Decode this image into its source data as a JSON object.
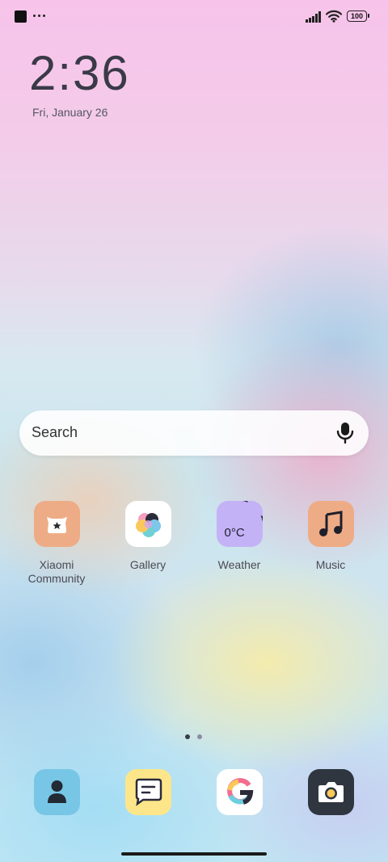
{
  "status_bar": {
    "battery": "100",
    "icons": [
      "app-notification-icon",
      "more-notifications-icon",
      "signal-icon",
      "wifi-icon",
      "battery-icon"
    ]
  },
  "lock": {
    "time": "2:36",
    "date": "Fri, January 26"
  },
  "search": {
    "placeholder": "Search",
    "icon": "mic-icon"
  },
  "apps": [
    {
      "label": "Xiaomi Community",
      "line1": "Xiaomi",
      "line2": "Community",
      "icon": "xiaomi-community-icon",
      "bg": "#eeac86"
    },
    {
      "label": "Gallery",
      "icon": "gallery-icon",
      "bg": "#ffffff"
    },
    {
      "label": "Weather",
      "icon": "weather-icon",
      "bg": "#c4b2f7",
      "temp": "0°C"
    },
    {
      "label": "Music",
      "icon": "music-icon",
      "bg": "#eeac86"
    }
  ],
  "pager": {
    "pages": 2,
    "current": 1,
    "active_color": "#3a3a48",
    "inactive_color": "#8c8ca0"
  },
  "dock": [
    {
      "icon": "contacts-icon",
      "bg": "#78c6e6"
    },
    {
      "icon": "messages-icon",
      "bg": "#fde68a"
    },
    {
      "icon": "google-icon",
      "bg": "#ffffff"
    },
    {
      "icon": "camera-icon",
      "bg": "#2f3640"
    }
  ]
}
